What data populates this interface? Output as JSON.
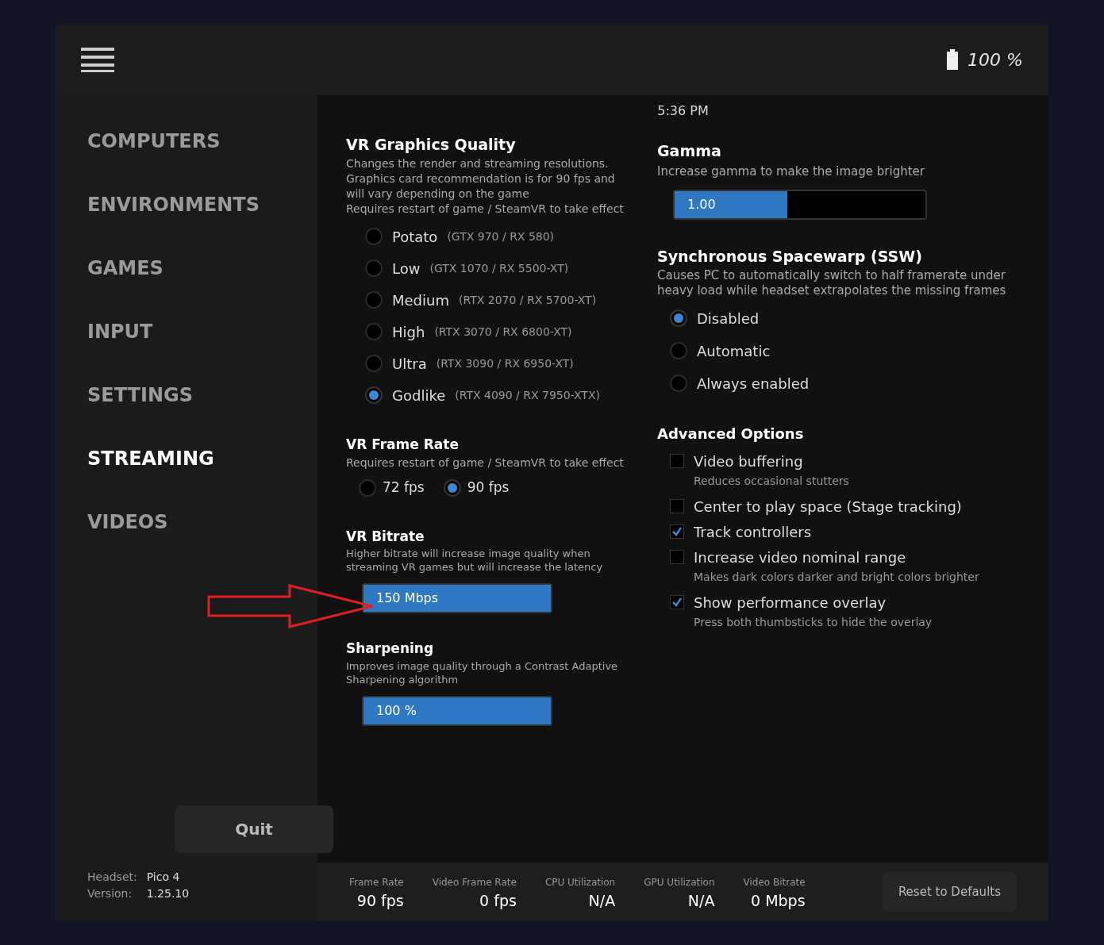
{
  "top_bar": {
    "battery": "100 %",
    "time": "5:36 PM"
  },
  "nav": [
    {
      "label": "COMPUTERS",
      "selected": false
    },
    {
      "label": "ENVIRONMENTS",
      "selected": false
    },
    {
      "label": "GAMES",
      "selected": false
    },
    {
      "label": "INPUT",
      "selected": false
    },
    {
      "label": "SETTINGS",
      "selected": false
    },
    {
      "label": "STREAMING",
      "selected": true
    },
    {
      "label": "VIDEOS",
      "selected": false
    }
  ],
  "quit_button": "Quit",
  "device_info": [
    {
      "label": "Headset:",
      "value": "Pico 4"
    },
    {
      "label": "Version:",
      "value": "1.25.10"
    }
  ],
  "graphics_quality": {
    "title": "VR Graphics Quality",
    "description": [
      "Changes the render and streaming resolutions.",
      "Graphics card recommendation is for 90 fps and will vary depending on the game",
      "Requires restart of game / SteamVR to take effect"
    ],
    "options": [
      {
        "label": "Potato",
        "hint": "(GTX 970 / RX 580)",
        "selected": false
      },
      {
        "label": "Low",
        "hint": "(GTX 1070 / RX 5500-XT)",
        "selected": false
      },
      {
        "label": "Medium",
        "hint": "(RTX 2070 / RX 5700-XT)",
        "selected": false
      },
      {
        "label": "High",
        "hint": "(RTX 3070 / RX 6800-XT)",
        "selected": false
      },
      {
        "label": "Ultra",
        "hint": "(RTX 3090 / RX 6950-XT)",
        "selected": false
      },
      {
        "label": "Godlike",
        "hint": "(RTX 4090 / RX 7950-XTX)",
        "selected": true
      }
    ]
  },
  "frame_rate": {
    "title": "VR Frame Rate",
    "description": "Requires restart of game / SteamVR to take effect",
    "options": [
      {
        "label": "72 fps",
        "selected": false
      },
      {
        "label": "90 fps",
        "selected": true
      }
    ]
  },
  "bitrate": {
    "title": "VR Bitrate",
    "description": "Higher bitrate will increase image quality when streaming VR games but will increase the latency",
    "value": "150 Mbps",
    "level": 1
  },
  "sharpening": {
    "title": "Sharpening",
    "description": "Improves image quality through a Contrast Adaptive Sharpening algorithm",
    "value": "100 %",
    "level": 1
  },
  "gamma": {
    "title": "Gamma",
    "description": "Increase gamma to make the image brighter",
    "value": "1.00",
    "level": 0.45
  },
  "ssw": {
    "title": "Synchronous Spacewarp (SSW)",
    "description": "Causes PC to automatically switch to half framerate under heavy load while headset extrapolates the missing frames",
    "options": [
      {
        "label": "Disabled",
        "selected": true
      },
      {
        "label": "Automatic",
        "selected": false
      },
      {
        "label": "Always enabled",
        "selected": false
      }
    ]
  },
  "advanced": {
    "title": "Advanced Options",
    "options": [
      {
        "label": "Video buffering",
        "hint": "Reduces occasional stutters",
        "checked": false
      },
      {
        "label": "Center to play space (Stage tracking)",
        "checked": false
      },
      {
        "label": "Track controllers",
        "checked": true
      },
      {
        "label": "Increase video nominal range",
        "hint": "Makes dark colors darker and bright colors brighter",
        "checked": false
      },
      {
        "label": "Show performance overlay",
        "hint": "Press both thumbsticks to hide the overlay",
        "checked": true
      }
    ]
  },
  "reset_button": "Reset to Defaults",
  "stats": [
    {
      "label": "Frame Rate",
      "value": "90 fps"
    },
    {
      "label": "Video Frame Rate",
      "value": "0 fps"
    },
    {
      "label": "CPU Utilization",
      "value": "N/A"
    },
    {
      "label": "GPU Utilization",
      "value": "N/A"
    },
    {
      "label": "Video Bitrate",
      "value": "0 Mbps"
    }
  ]
}
